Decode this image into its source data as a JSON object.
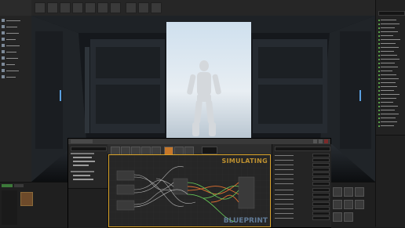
{
  "viewport": {
    "scene": "3d-level-viewport",
    "character": "mannequin",
    "door": "open-doorway"
  },
  "blueprint_editor": {
    "status_overlay": "SIMULATING",
    "watermark": "BLUEPRINT"
  },
  "colors": {
    "accent_orange": "#d9a227",
    "play_active": "#c7782a",
    "panel_bg": "#242424",
    "graph_bg": "#262626"
  },
  "icons": {
    "play": "play-icon",
    "save": "save-icon",
    "settings": "gear-icon"
  }
}
